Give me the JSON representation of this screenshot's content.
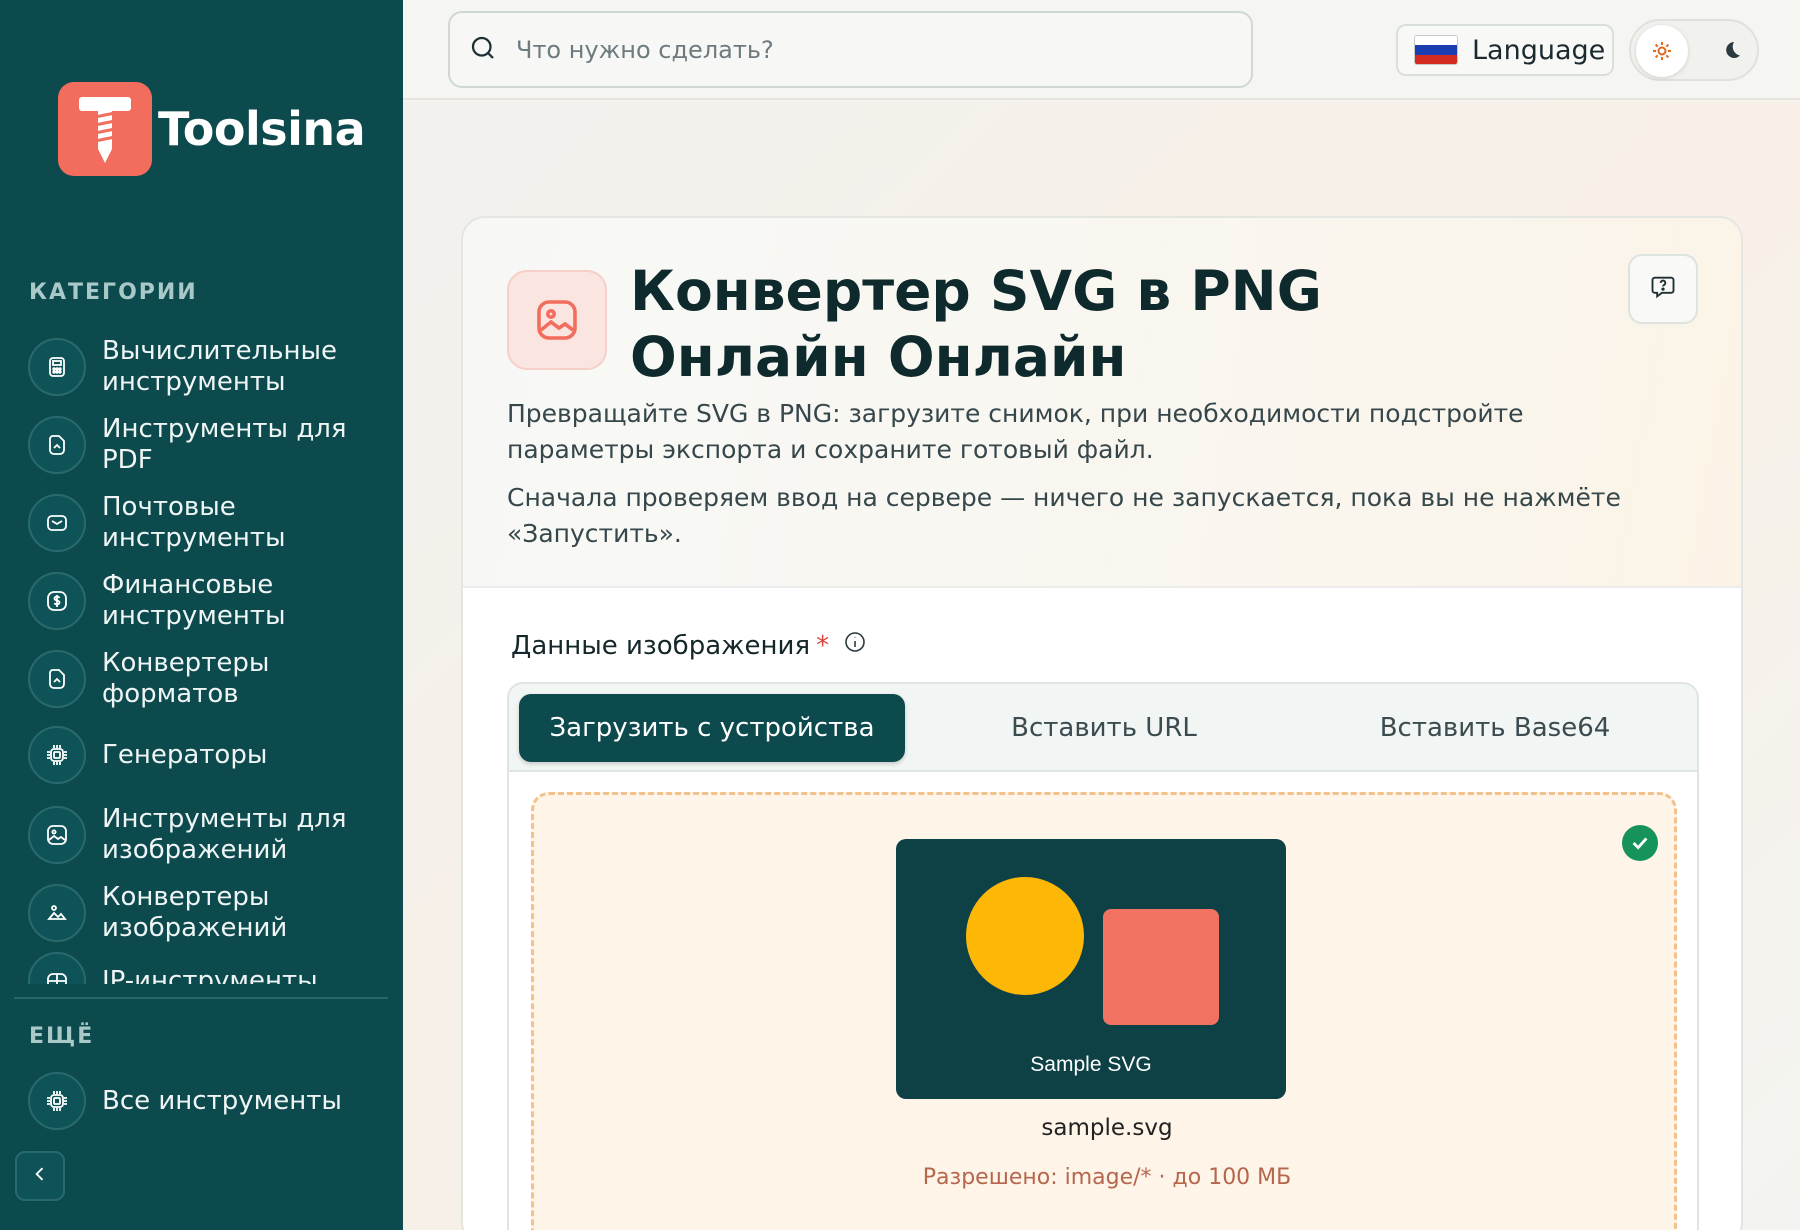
{
  "brand": {
    "name": "Toolsina",
    "accent": "#f26d5d",
    "sidebar_bg": "#0c4a4e"
  },
  "search": {
    "placeholder": "Что нужно сделать?"
  },
  "header": {
    "language_label": "Language"
  },
  "sidebar": {
    "categories_title": "КАТЕГОРИИ",
    "items": [
      {
        "label": "Вычислительные инструменты",
        "icon": "calculator-icon"
      },
      {
        "label": "Инструменты для PDF",
        "icon": "file-icon"
      },
      {
        "label": "Почтовые инструменты",
        "icon": "mail-icon"
      },
      {
        "label": "Финансовые инструменты",
        "icon": "dollar-icon"
      },
      {
        "label": "Конвертеры форматов",
        "icon": "file-convert-icon"
      },
      {
        "label": "Генераторы",
        "icon": "chip-icon"
      },
      {
        "label": "Инструменты для изображений",
        "icon": "image-icon"
      },
      {
        "label": "Конвертеры изображений",
        "icon": "image-convert-icon"
      },
      {
        "label": "IP-инструменты",
        "icon": "network-icon"
      }
    ],
    "more_title": "ЕЩЁ",
    "all_tools_label": "Все инструменты"
  },
  "tool": {
    "title_part1_bold": "Конвертер",
    "title_part2": " SVG в PNG ",
    "title_part3_bold": "Онлайн Онлайн",
    "description": "Превращайте SVG в PNG: загрузите снимок, при необходимости подстройте параметры экспорта и сохраните готовый файл.",
    "note": "Сначала проверяем ввод на сервере — ничего не запускается, пока вы не нажмёте «Запустить»."
  },
  "input": {
    "label": "Данные изображения",
    "required_mark": "*",
    "tabs": [
      {
        "label": "Загрузить с устройства",
        "active": true
      },
      {
        "label": "Вставить URL",
        "active": false
      },
      {
        "label": "Вставить Base64",
        "active": false
      }
    ],
    "preview_label": "Sample SVG",
    "file_name": "sample.svg",
    "allowed": "Разрешено: image/* · до 100 МБ"
  }
}
